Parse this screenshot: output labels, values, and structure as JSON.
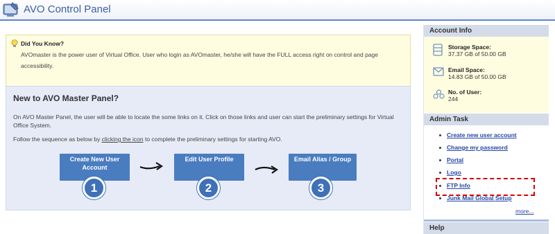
{
  "header": {
    "title": "AVO Control Panel",
    "icon": "control-panel-icon"
  },
  "tip": {
    "title": "Did You Know?",
    "body": "AVOmaster is the power user of Virtual Office. User who login as AVOmaster, he/she will have the FULL access right on control and page accessibility.",
    "icon": "lightbulb-icon"
  },
  "panel": {
    "title": "New to AVO Master Panel?",
    "intro": "On AVO Master Panel, the user will be able to locate the some links on it. Click on those links and user can start the preliminary settings for Virtual Office System.",
    "sequence_before": "Follow the sequence as below by ",
    "sequence_link": "clicking the icon",
    "sequence_after": " to complete the preliminary settings for starting AVO.",
    "steps": [
      {
        "label": "Create New User Account",
        "number": "1"
      },
      {
        "label": "Edit User Profile",
        "number": "2"
      },
      {
        "label": "Email Alias / Group",
        "number": "3"
      }
    ]
  },
  "account": {
    "heading": "Account Info",
    "storage_label": "Storage Space:",
    "storage_value": "37.37 GB of 50.00 GB",
    "email_label": "Email Space:",
    "email_value": "14.83 GB of 50.00 GB",
    "users_label": "No. of User:",
    "users_value": "244"
  },
  "admin": {
    "heading": "Admin Task",
    "items": [
      "Create new user account",
      "Change my password",
      "Portal",
      "Logo",
      "FTP Info",
      "Junk Mail Global Setup"
    ],
    "more": "more...",
    "highlighted_item": "FTP Info",
    "highlight_color": "#d40000"
  },
  "help": {
    "heading": "Help"
  },
  "colors": {
    "accent": "#4a7cc0",
    "header_text": "#3a5fa6",
    "link": "#2546a5",
    "tip_bg": "#fffde0",
    "panel_bg": "#e6ebf7"
  }
}
